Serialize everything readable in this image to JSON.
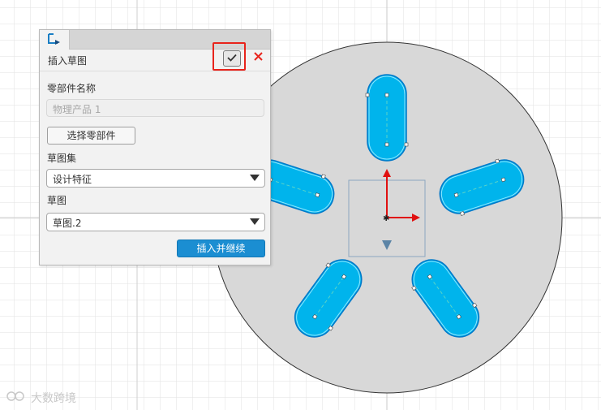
{
  "panel": {
    "title": "插入草图",
    "tab_icon": "insert-sketch-icon",
    "confirm_icon": "check-icon",
    "close_icon": "close-icon",
    "part_name_label": "零部件名称",
    "part_name_placeholder": "物理产品 1",
    "select_part_label": "选择零部件",
    "sketch_set_label": "草图集",
    "sketch_set_value": "设计特征",
    "sketch_label": "草图",
    "sketch_value": "草图.2",
    "insert_continue_label": "插入并继续"
  },
  "canvas": {
    "disk_color": "#d8d8d8",
    "slot_color": "#00b4ec",
    "axis_color": "#e01010"
  },
  "watermark": {
    "text": "大数跨境"
  }
}
